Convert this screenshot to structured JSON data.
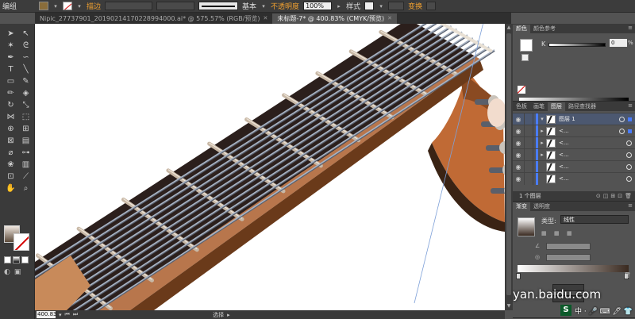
{
  "app": {
    "menu_edit": "编组"
  },
  "control_bar": {
    "stroke_label": "描边",
    "stroke_style": "基本",
    "opacity_label": "不透明度",
    "opacity_value": "100%",
    "style_label": "样式",
    "transform_label": "变换"
  },
  "tabs": [
    {
      "label": "Nipic_27737901_20190214170228994000.ai* @ 575.57% (RGB/预览)",
      "active": false
    },
    {
      "label": "未标题-7* @ 400.83% (CMYK/预览)",
      "active": true
    }
  ],
  "color_panel": {
    "tabs": [
      "颜色",
      "颜色参考"
    ],
    "channel": "K",
    "value": "0",
    "unit": "%"
  },
  "layers_panel": {
    "tabs": [
      "色板",
      "画笔",
      "图层",
      "路径查找器"
    ],
    "layer_name": "图层 1",
    "sublayers": [
      "<...",
      "<...",
      "<...",
      "<...",
      "<..."
    ],
    "footer": "1 个图层"
  },
  "gradient_panel": {
    "tabs": [
      "渐变",
      "透明度"
    ],
    "type_label": "类型:",
    "type_value": "线性"
  },
  "status": {
    "zoom": "400.83",
    "mode": "选择"
  },
  "colors": {
    "fretboard": "#2b1f1c",
    "fret_wire": "#c8b8a6",
    "string": "#a9b4c4",
    "neck_edge": "#b8764c",
    "headstock": "#c06a35",
    "artboard": "#ffffff",
    "accent_selection": "#4a7cff"
  },
  "watermark": {
    "text": "yan.baidu.com",
    "ime_label": "S",
    "ime_chars": "中 · 🎤 ⌨ 🖊 👕"
  },
  "icons": {
    "tools": [
      "selection-tool-icon",
      "direct-selection-tool-icon",
      "magic-wand-tool-icon",
      "lasso-tool-icon",
      "pen-tool-icon",
      "curvature-tool-icon",
      "type-tool-icon",
      "line-tool-icon",
      "rectangle-tool-icon",
      "paintbrush-tool-icon",
      "pencil-tool-icon",
      "eraser-tool-icon",
      "rotate-tool-icon",
      "scale-tool-icon",
      "width-tool-icon",
      "free-transform-tool-icon",
      "shape-builder-tool-icon",
      "perspective-tool-icon",
      "mesh-tool-icon",
      "gradient-tool-icon",
      "eyedropper-tool-icon",
      "blend-tool-icon",
      "symbol-sprayer-tool-icon",
      "column-graph-tool-icon",
      "artboard-tool-icon",
      "slice-tool-icon",
      "hand-tool-icon",
      "zoom-tool-icon"
    ]
  }
}
